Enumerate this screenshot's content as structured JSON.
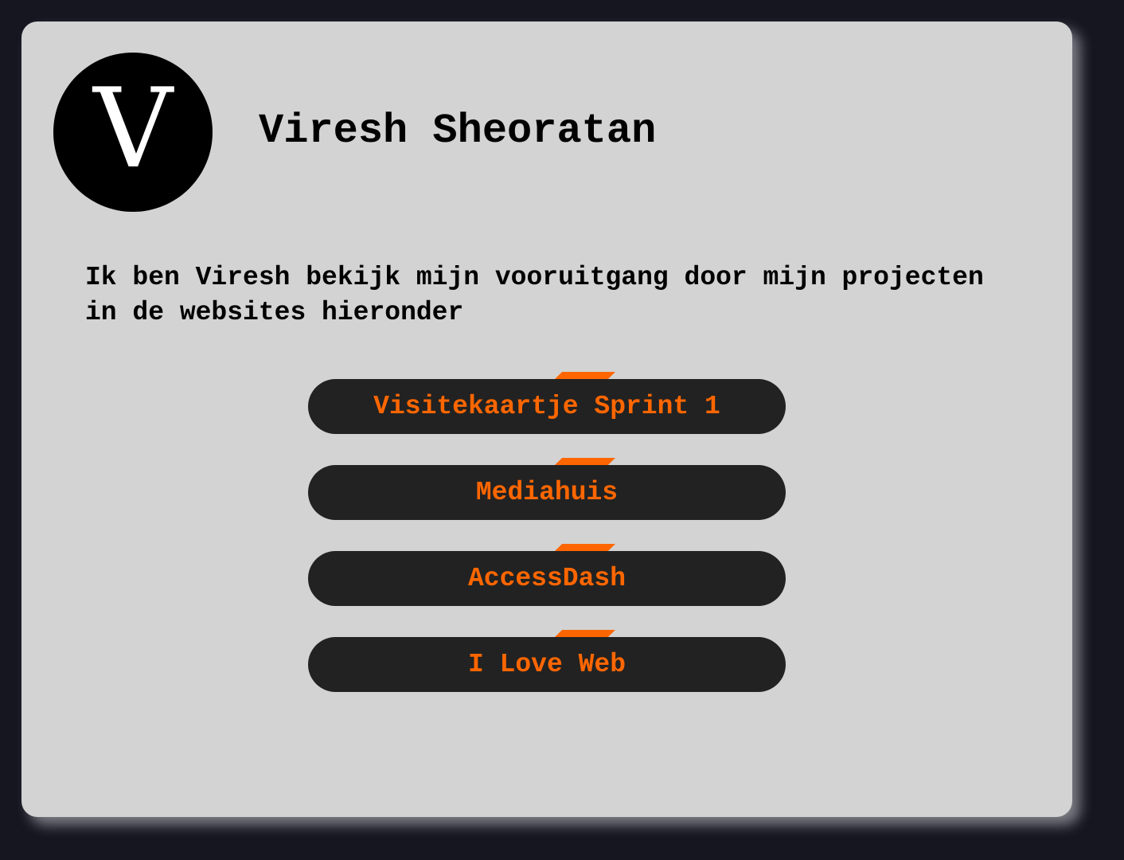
{
  "profile": {
    "logo_letter": "V",
    "name": "Viresh Sheoratan",
    "intro": "Ik ben Viresh bekijk mijn vooruitgang door mijn projecten in de websites hieronder"
  },
  "links": [
    {
      "label": "Visitekaartje Sprint 1"
    },
    {
      "label": "Mediahuis"
    },
    {
      "label": "AccessDash"
    },
    {
      "label": "I Love Web"
    }
  ],
  "colors": {
    "page_background": "#161621",
    "card_background": "#d3d3d3",
    "button_background": "#222222",
    "accent": "#ff6600",
    "logo_background": "#000000",
    "logo_letter": "#ffffff"
  }
}
